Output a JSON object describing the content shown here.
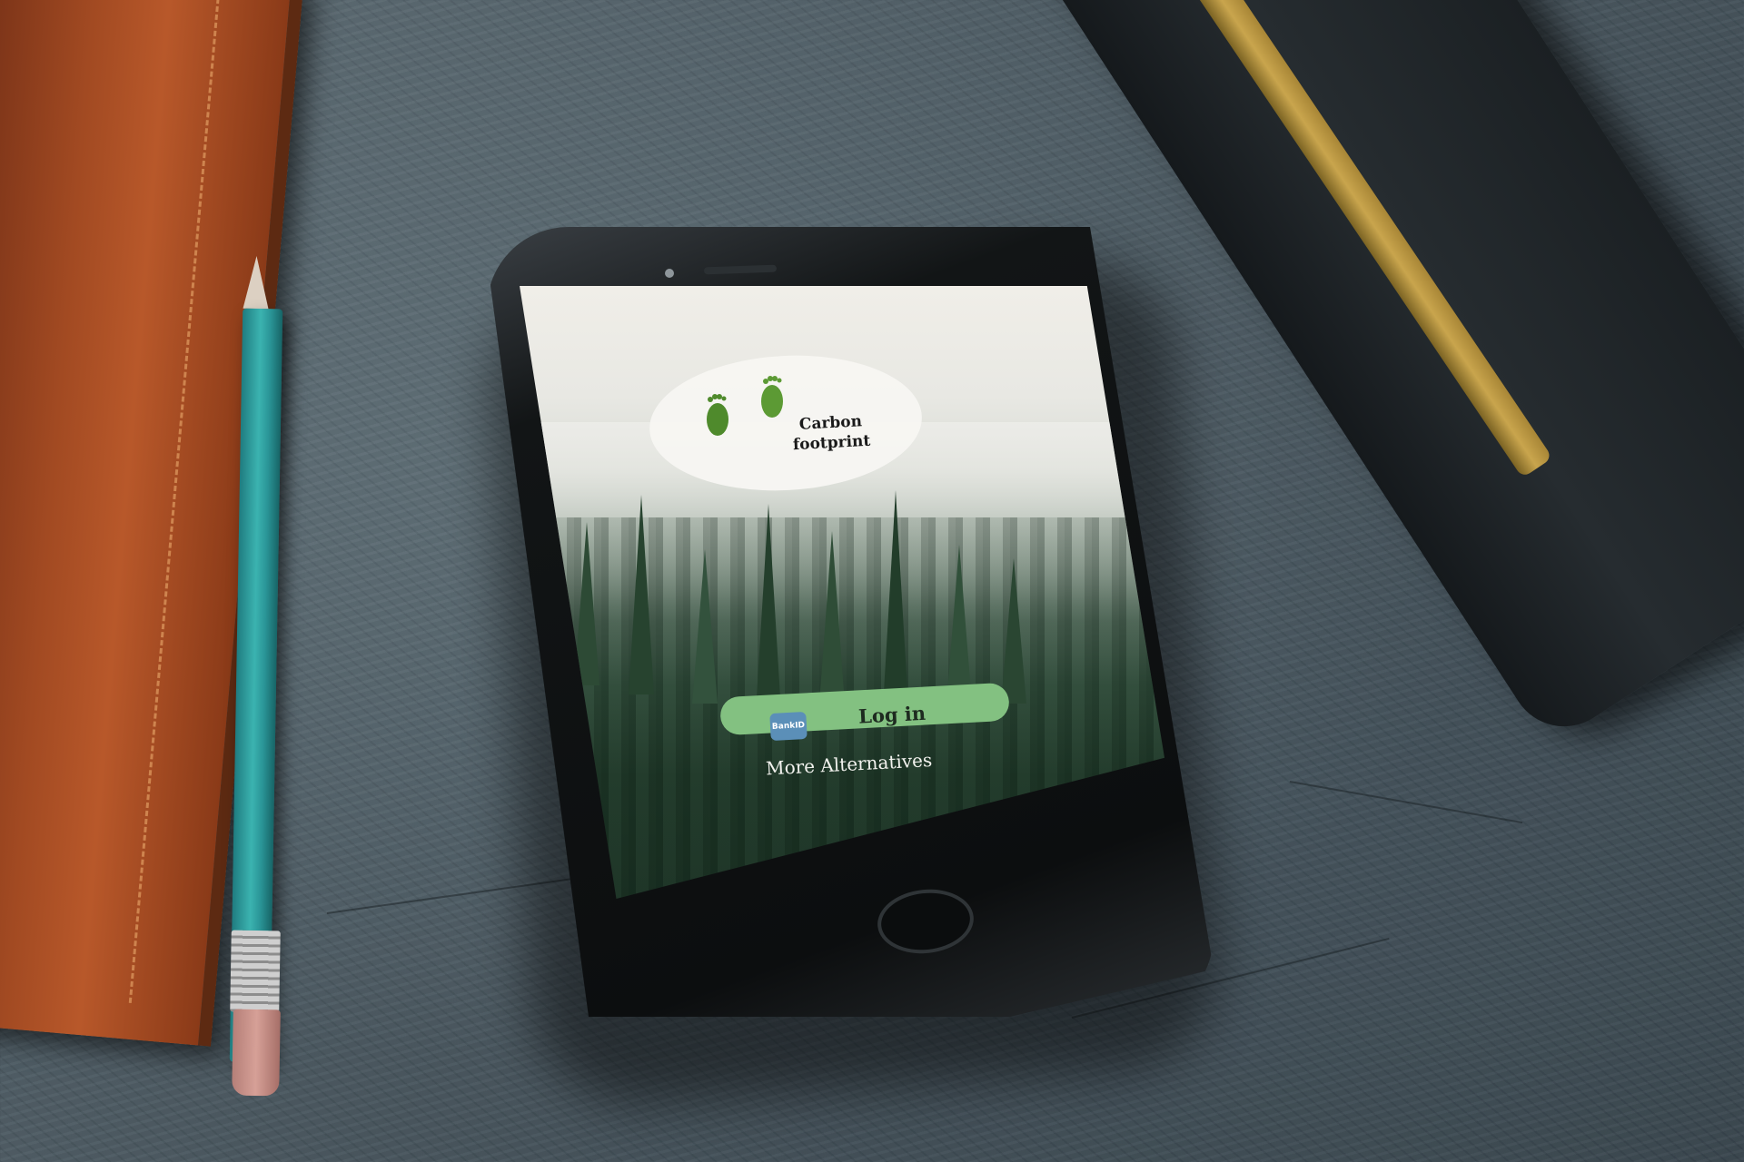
{
  "app": {
    "logo_title": "Carbon footprint",
    "logo_icon": "footprints-icon",
    "bankid_icon": "bankid-icon",
    "bankid_text": "BankID",
    "login_label": "Log in",
    "alternatives_label": "More Alternatives"
  },
  "colors": {
    "login_button": "#83c181",
    "footprint_green": "#4f8a2c",
    "logo_background": "#f7f6f2",
    "alternatives_text": "#f2f2ee"
  }
}
